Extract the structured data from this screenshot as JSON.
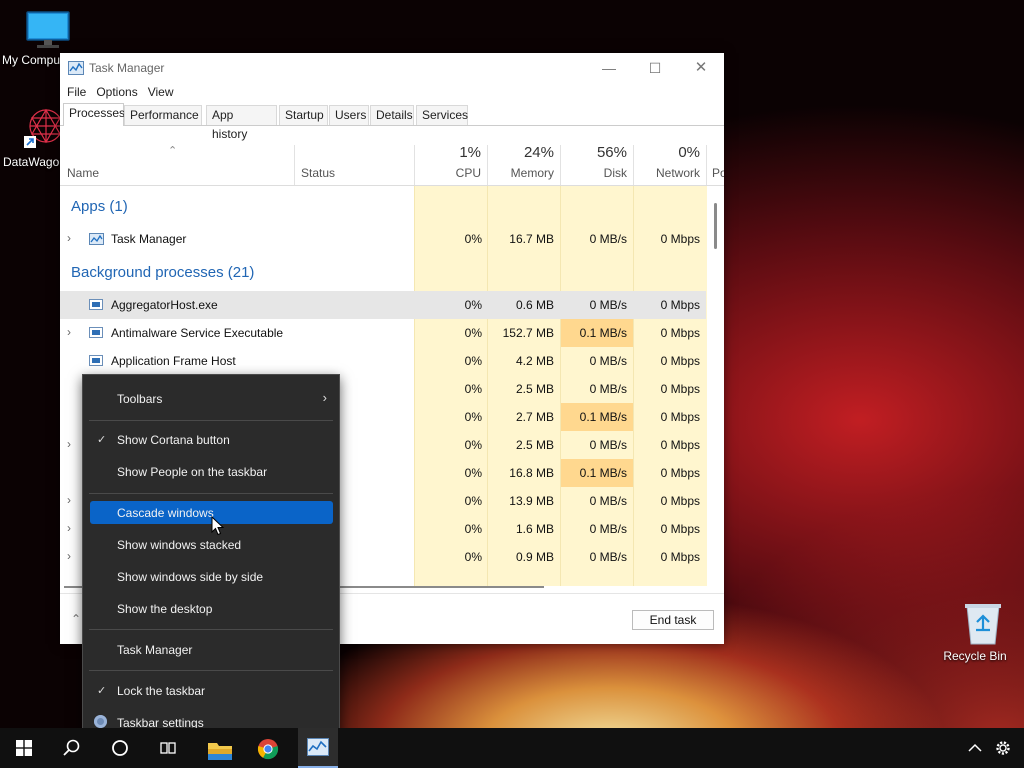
{
  "desktop": {
    "icons": [
      {
        "label": "My Compu",
        "icon": "monitor-icon"
      },
      {
        "label": "DataWagon",
        "icon": "datawagon-icon"
      },
      {
        "label": "Recycle Bin",
        "icon": "recycle-bin-icon"
      }
    ]
  },
  "task_manager": {
    "title": "Task Manager",
    "menu": [
      "File",
      "Options",
      "View"
    ],
    "tabs": [
      "Processes",
      "Performance",
      "App history",
      "Startup",
      "Users",
      "Details",
      "Services"
    ],
    "active_tab": "Processes",
    "columns": {
      "name": "Name",
      "status": "Status",
      "cpu": {
        "pct": "1%",
        "label": "CPU"
      },
      "memory": {
        "pct": "24%",
        "label": "Memory"
      },
      "disk": {
        "pct": "56%",
        "label": "Disk"
      },
      "network": {
        "pct": "0%",
        "label": "Network"
      },
      "power": "Po"
    },
    "groups": {
      "apps": "Apps (1)",
      "background": "Background processes (21)"
    },
    "apps": [
      {
        "name": "Task Manager",
        "cpu": "0%",
        "memory": "16.7 MB",
        "disk": "0 MB/s",
        "network": "0 Mbps"
      }
    ],
    "background": [
      {
        "name": "AggregatorHost.exe",
        "cpu": "0%",
        "memory": "0.6 MB",
        "disk": "0 MB/s",
        "network": "0 Mbps"
      },
      {
        "name": "Antimalware Service Executable",
        "cpu": "0%",
        "memory": "152.7 MB",
        "disk": "0.1 MB/s",
        "network": "0 Mbps"
      },
      {
        "name": "Application Frame Host",
        "cpu": "0%",
        "memory": "4.2 MB",
        "disk": "0 MB/s",
        "network": "0 Mbps"
      },
      {
        "name": "",
        "cpu": "0%",
        "memory": "2.5 MB",
        "disk": "0 MB/s",
        "network": "0 Mbps"
      },
      {
        "name": "",
        "cpu": "0%",
        "memory": "2.7 MB",
        "disk": "0.1 MB/s",
        "network": "0 Mbps"
      },
      {
        "name": "",
        "cpu": "0%",
        "memory": "2.5 MB",
        "disk": "0 MB/s",
        "network": "0 Mbps"
      },
      {
        "name": "",
        "cpu": "0%",
        "memory": "16.8 MB",
        "disk": "0.1 MB/s",
        "network": "0 Mbps"
      },
      {
        "name": "",
        "cpu": "0%",
        "memory": "13.9 MB",
        "disk": "0 MB/s",
        "network": "0 Mbps"
      },
      {
        "name": "",
        "cpu": "0%",
        "memory": "1.6 MB",
        "disk": "0 MB/s",
        "network": "0 Mbps"
      },
      {
        "name": "",
        "cpu": "0%",
        "memory": "0.9 MB",
        "disk": "0 MB/s",
        "network": "0 Mbps"
      }
    ],
    "end_task": "End task"
  },
  "context_menu": {
    "toolbars": "Toolbars",
    "show_cortana": "Show Cortana button",
    "show_people": "Show People on the taskbar",
    "cascade": "Cascade windows",
    "stacked": "Show windows stacked",
    "side_by_side": "Show windows side by side",
    "show_desktop": "Show the desktop",
    "task_manager": "Task Manager",
    "lock_taskbar": "Lock the taskbar",
    "taskbar_settings": "Taskbar settings"
  },
  "colors": {
    "accent": "#0a64c8",
    "group_text": "#2166b4",
    "heat_light": "#fff6cf",
    "heat_medium": "#ffd88f",
    "taskbar": "#101010",
    "menu_bg": "#2b2b2b"
  }
}
